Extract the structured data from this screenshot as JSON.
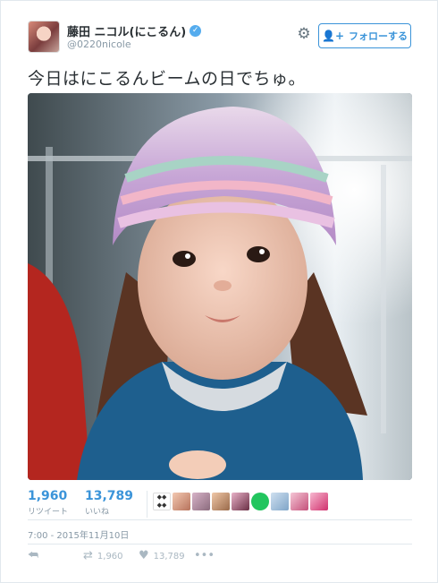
{
  "author": {
    "display_name": "藤田 ニコル(にこるん)",
    "handle": "@0220nicole",
    "verified_glyph": "✓"
  },
  "header": {
    "follow_label": "フォローする",
    "follow_icon": "person-plus-icon",
    "settings_icon": "gear-icon"
  },
  "tweet": {
    "text": "今日はにこるんビームの日でちゅ。",
    "photo_description_icon": "photo"
  },
  "stats": {
    "retweets": {
      "count": "1,960",
      "label": "リツイート"
    },
    "likes": {
      "count": "13,789",
      "label": "いいね"
    }
  },
  "timestamp": "7:00 - 2015年11月10日",
  "actions": {
    "reply_icon": "reply-icon",
    "retweet_icon": "retweet-icon",
    "retweet_count": "1,960",
    "like_icon": "heart-icon",
    "like_count": "13,789",
    "more_icon": "more-icon",
    "more_glyph": "•••"
  },
  "colors": {
    "accent": "#3b94d9",
    "muted": "#8899a6",
    "text": "#292f33"
  }
}
